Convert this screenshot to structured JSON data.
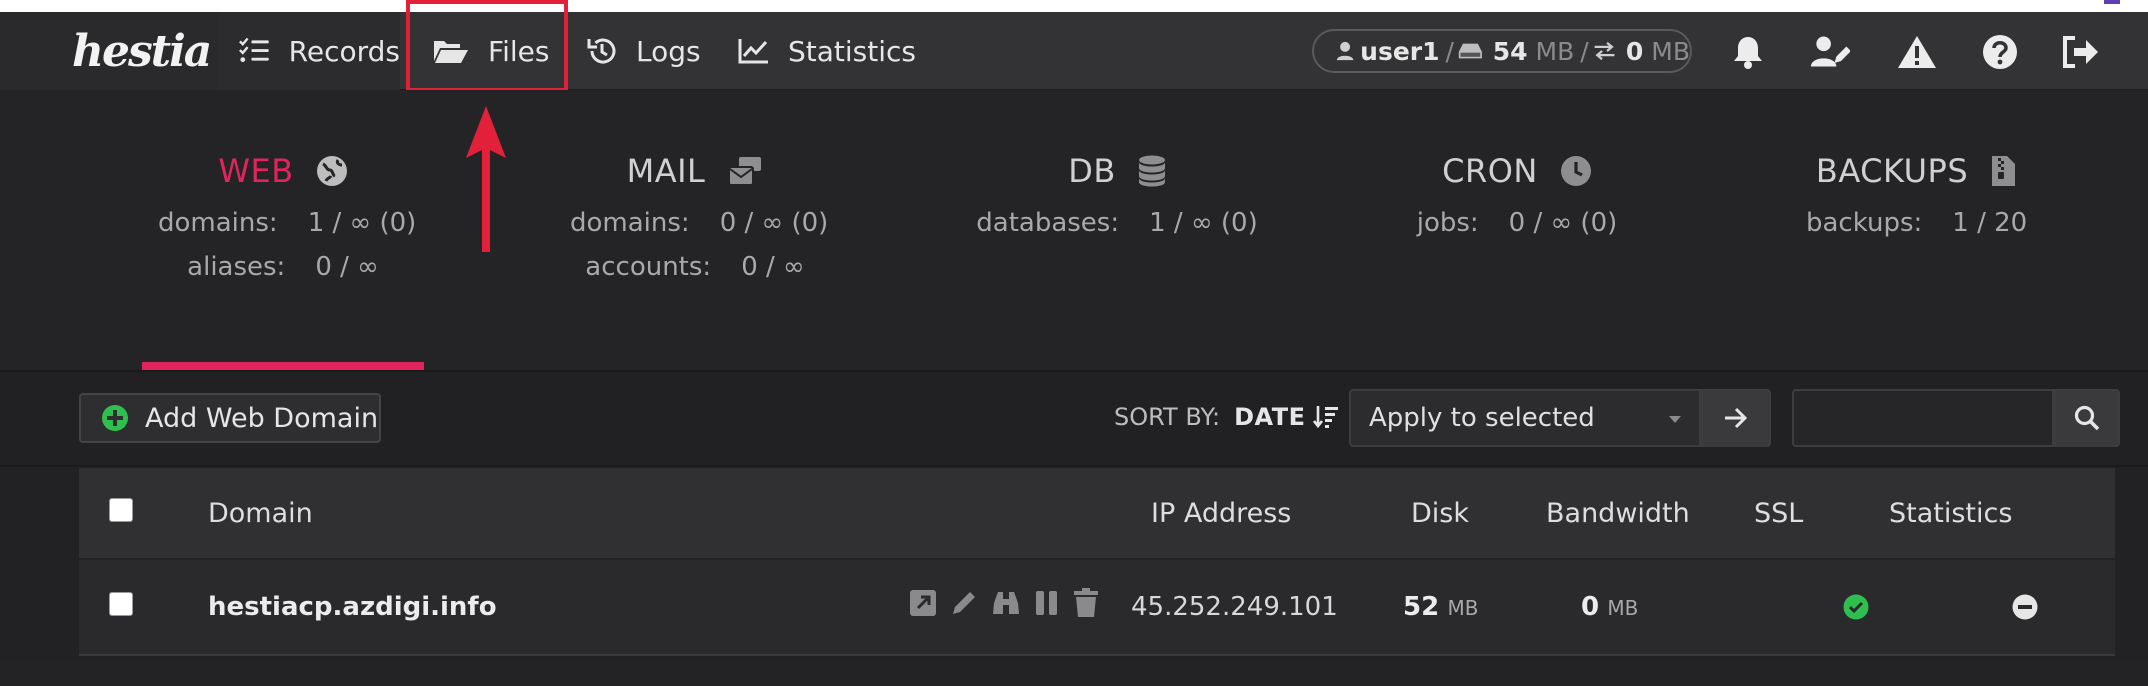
{
  "nav": {
    "logo": "hestia",
    "items": [
      {
        "label": "Records",
        "icon": "list-icon"
      },
      {
        "label": "Files",
        "icon": "folder-open-icon"
      },
      {
        "label": "Logs",
        "icon": "history-icon"
      },
      {
        "label": "Statistics",
        "icon": "chart-line-icon"
      }
    ],
    "user": {
      "name": "user1",
      "disk_value": "54",
      "disk_unit": "MB",
      "bw_value": "0",
      "bw_unit": "MB",
      "separator": "/"
    },
    "right_icons": [
      "bell-icon",
      "user-edit-icon",
      "warning-icon",
      "help-icon",
      "logout-icon"
    ]
  },
  "stats": [
    {
      "title": "WEB",
      "active": true,
      "icon": "globe-icon",
      "rows": [
        {
          "label": "domains:",
          "value": "1 / ∞ (0)"
        },
        {
          "label": "aliases:",
          "value": "0 / ∞"
        }
      ]
    },
    {
      "title": "MAIL",
      "active": false,
      "icon": "mail-bulk-icon",
      "rows": [
        {
          "label": "domains:",
          "value": "0 / ∞ (0)"
        },
        {
          "label": "accounts:",
          "value": "0 / ∞"
        }
      ]
    },
    {
      "title": "DB",
      "active": false,
      "icon": "database-icon",
      "rows": [
        {
          "label": "databases:",
          "value": "1 / ∞ (0)"
        }
      ]
    },
    {
      "title": "CRON",
      "active": false,
      "icon": "clock-icon",
      "rows": [
        {
          "label": "jobs:",
          "value": "0 / ∞ (0)"
        }
      ]
    },
    {
      "title": "BACKUPS",
      "active": false,
      "icon": "file-archive-icon",
      "rows": [
        {
          "label": "backups:",
          "value": "1 / 20"
        }
      ]
    }
  ],
  "toolbar": {
    "add_label": "Add Web Domain",
    "sort_label": "SORT BY:",
    "sort_value": "DATE",
    "apply_label": "Apply to selected"
  },
  "table": {
    "headers": [
      "Domain",
      "IP Address",
      "Disk",
      "Bandwidth",
      "SSL",
      "Statistics"
    ],
    "rows": [
      {
        "domain": "hestiacp.azdigi.info",
        "ip": "45.252.249.101",
        "disk_value": "52",
        "disk_unit": "MB",
        "bw_value": "0",
        "bw_unit": "MB",
        "ssl": "check-circle-icon",
        "statistics": "minus-circle-icon"
      }
    ]
  },
  "colors": {
    "accent": "#e0245e",
    "highlight": "#e3203a",
    "ssl_ok": "#2fbf4f"
  }
}
